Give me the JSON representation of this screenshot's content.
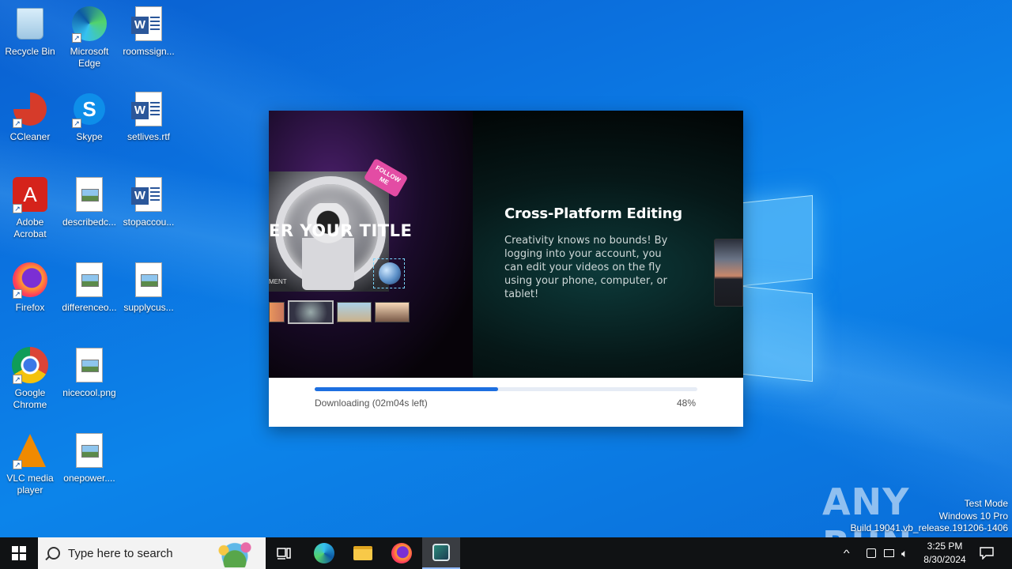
{
  "desktop": {
    "icons": [
      {
        "label": "Recycle Bin",
        "glyph": "recycle-bin"
      },
      {
        "label": "Microsoft Edge",
        "glyph": "edge"
      },
      {
        "label": "roomssign...",
        "glyph": "word-doc"
      },
      {
        "label": "CCleaner",
        "glyph": "ccleaner"
      },
      {
        "label": "Skype",
        "glyph": "skype"
      },
      {
        "label": "setlives.rtf",
        "glyph": "word-doc"
      },
      {
        "label": "Adobe Acrobat",
        "glyph": "acrobat"
      },
      {
        "label": "describedc...",
        "glyph": "image-file"
      },
      {
        "label": "stopaccou...",
        "glyph": "word-doc"
      },
      {
        "label": "Firefox",
        "glyph": "firefox"
      },
      {
        "label": "differenceo...",
        "glyph": "image-file"
      },
      {
        "label": "supplycus...",
        "glyph": "image-file"
      },
      {
        "label": "Google Chrome",
        "glyph": "chrome"
      },
      {
        "label": "nicecool.png",
        "glyph": "image-file"
      },
      {
        "label": "VLC media player",
        "glyph": "vlc"
      },
      {
        "label": "onepower....",
        "glyph": "image-file"
      }
    ]
  },
  "installer": {
    "banner": {
      "preview_title": "ER YOUR TITLE",
      "sticker": "FOLLOW ME",
      "side_text": "MENT"
    },
    "feature_title": "Cross-Platform Editing",
    "feature_description": "Creativity knows no bounds! By logging into your account, you can edit your videos on the fly using your phone, computer, or tablet!",
    "progress": {
      "status": "Downloading (02m04s left)",
      "percent_label": "48%",
      "value": 0.48
    }
  },
  "watermark": {
    "brand": "ANY RUN",
    "mode": "Test Mode",
    "os": "Windows 10 Pro",
    "build": "Build 19041.vb_release.191206-1406"
  },
  "taskbar": {
    "search_placeholder": "Type here to search",
    "pinned": [
      "task-view",
      "edge",
      "file-explorer",
      "firefox",
      "installer-app"
    ],
    "clock_time": "3:25 PM",
    "clock_date": "8/30/2024",
    "colors": {
      "accent": "#1d6fe0",
      "taskbar": "#101214"
    }
  }
}
